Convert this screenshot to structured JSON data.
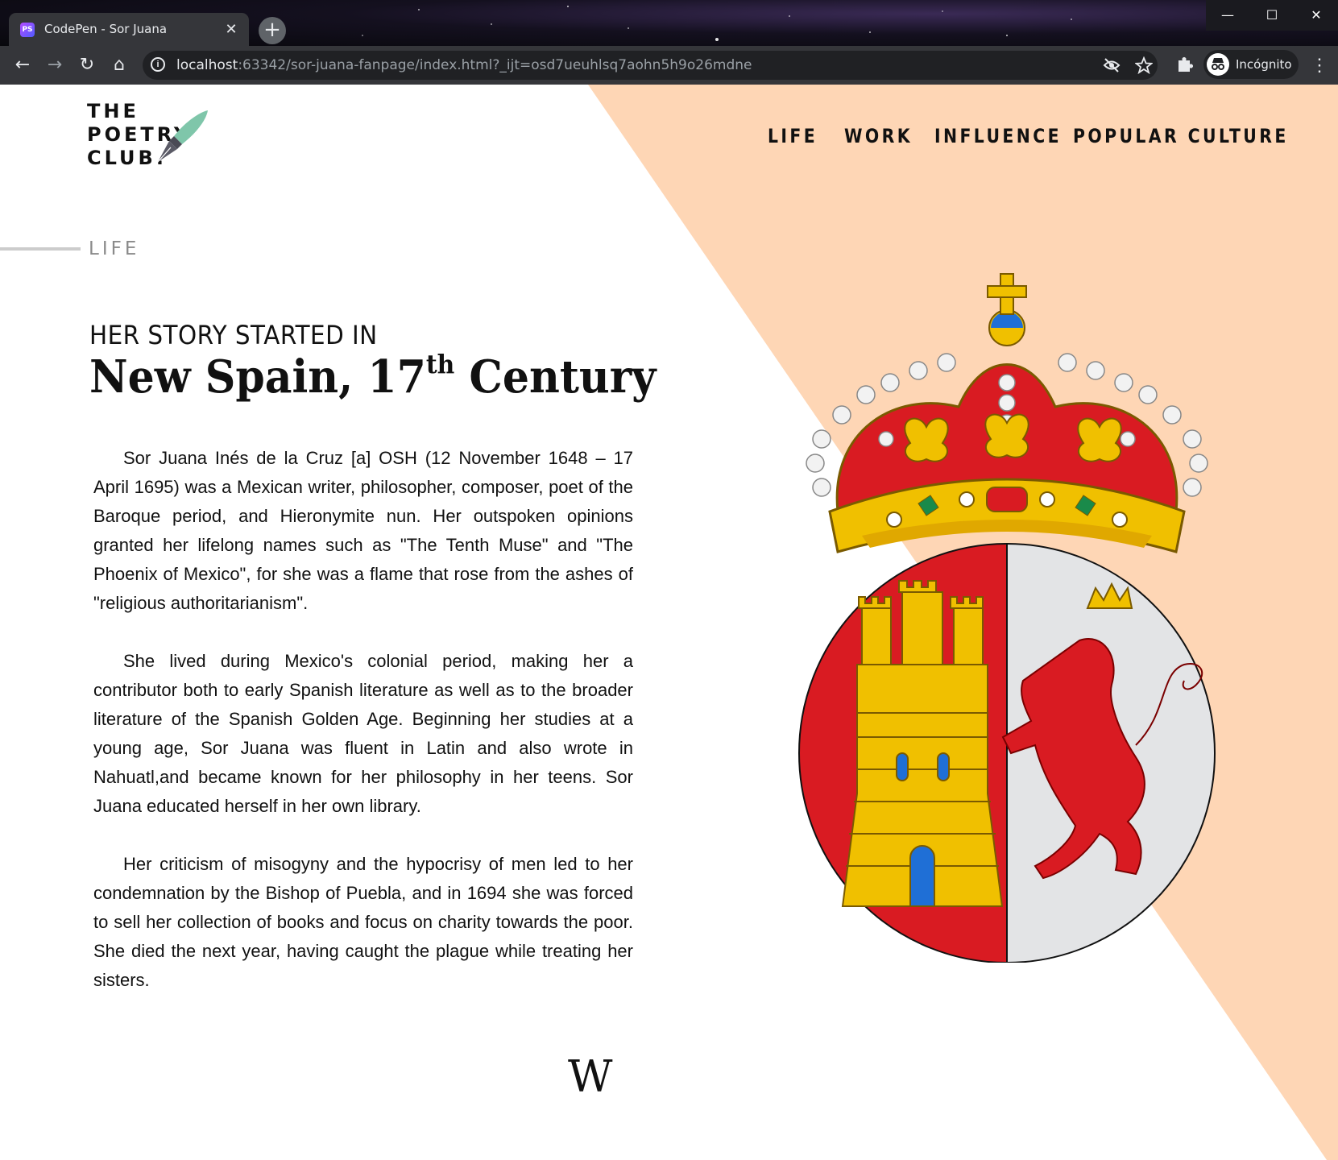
{
  "browser": {
    "tab_title": "CodePen - Sor Juana",
    "tab_favicon": "PS",
    "tab_close": "✕",
    "new_tab": "+",
    "url_host": "localhost",
    "url_rest": ":63342/sor-juana-fanpage/index.html?_ijt=osd7ueuhlsq7aohn5h9o26mdne",
    "profile_label": "Incógnito",
    "window_controls": {
      "minimize": "—",
      "maximize": "☐",
      "close": "✕"
    },
    "nav_icons": {
      "back": "←",
      "forward": "→",
      "reload": "↻",
      "home": "⌂"
    }
  },
  "site": {
    "logo_lines": [
      "THE",
      "POETRY",
      "CLUB."
    ],
    "nav": [
      "LIFE",
      "WORK",
      "INFLUENCE",
      "POPULAR CULTURE"
    ],
    "section_label": "LIFE",
    "kicker": "HER STORY STARTED IN",
    "headline_main": "New Spain, 17",
    "headline_sup": "th",
    "headline_end": " Century",
    "paragraphs": [
      "Sor Juana Inés de la Cruz [a] OSH (12 November 1648 – 17 April 1695) was a Mexican writer, philosopher, composer, poet of the Baroque period, and Hieronymite nun. Her outspoken opinions granted her lifelong names such as \"The Tenth Muse\" and \"The Phoenix of Mexico\", for she was a flame that rose from the ashes of \"religious authoritarianism\".",
      "She lived during Mexico's colonial period, making her a contributor both to early Spanish literature as well as to the broader literature of the Spanish Golden Age. Beginning her studies at a young age, Sor Juana was fluent in Latin and also wrote in Nahuatl,and became known for her philosophy in her teens. Sor Juana educated herself in her own library.",
      "Her criticism of misogyny and the hypocrisy of men led to her condemnation by the Bishop of Puebla, and in 1694 she was forced to sell her collection of books and focus on charity towards the poor. She died the next year, having caught the plague while treating her sisters."
    ],
    "wiki_mark": "W"
  },
  "colors": {
    "peach": "#fed6b5",
    "shield_red": "#d91b22",
    "shield_silver": "#e3e4e6",
    "gold": "#f0c000",
    "pen_teal": "#7fc6aa"
  }
}
